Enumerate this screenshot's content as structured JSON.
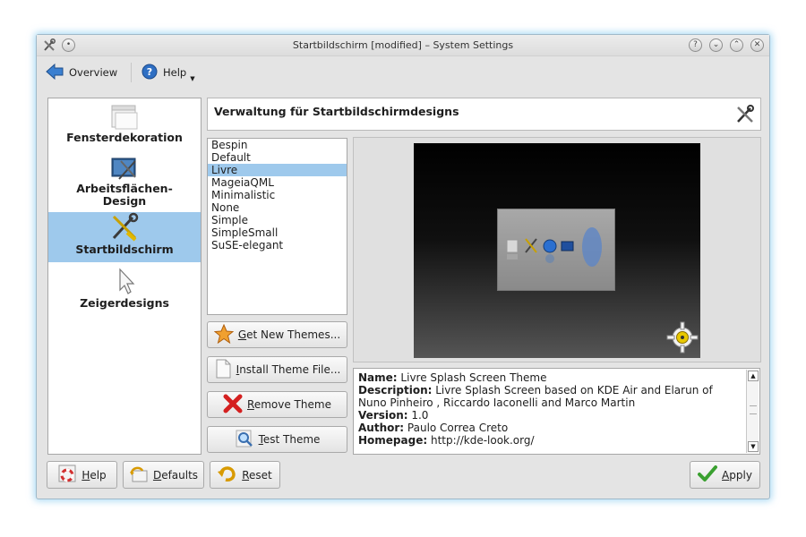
{
  "window": {
    "title": "Startbildschirm [modified] – System Settings"
  },
  "toolbar": {
    "overview_label": "Overview",
    "help_label": "Help"
  },
  "sidebar": {
    "items": [
      {
        "label": "Fensterdekoration",
        "icon": "window-icon"
      },
      {
        "label": "Arbeitsflächen-Design",
        "icon": "desktop-theme-icon"
      },
      {
        "label": "Startbildschirm",
        "icon": "tools-icon",
        "selected": true
      },
      {
        "label": "Zeigerdesigns",
        "icon": "pointer-icon"
      }
    ]
  },
  "header": {
    "title": "Verwaltung für Startbildschirmdesigns"
  },
  "themes": {
    "items": [
      "Bespin",
      "Default",
      "Livre",
      "MageiaQML",
      "Minimalistic",
      "None",
      "Simple",
      "SimpleSmall",
      "SuSE-elegant"
    ],
    "selected": "Livre"
  },
  "buttons": {
    "get_new": {
      "mnemonic": "G",
      "rest": "et New Themes..."
    },
    "install": {
      "mnemonic": "I",
      "rest": "nstall Theme File..."
    },
    "remove": {
      "mnemonic": "R",
      "rest": "emove Theme"
    },
    "test": {
      "mnemonic": "T",
      "rest": "est Theme"
    }
  },
  "info": {
    "name_label": "Name:",
    "name_value": "Livre Splash Screen Theme",
    "desc_label": "Description:",
    "desc_value": "Livre Splash Screen based on KDE Air and Elarun of Nuno Pinheiro , Riccardo Iaconelli and Marco Martin",
    "version_label": "Version:",
    "version_value": "1.0",
    "author_label": "Author:",
    "author_value": "Paulo Correa Creto",
    "homepage_label": "Homepage:",
    "homepage_value": "http://kde-look.org/"
  },
  "footer": {
    "help": {
      "mnemonic": "H",
      "rest": "elp"
    },
    "defaults": {
      "mnemonic": "D",
      "rest": "efaults"
    },
    "reset": {
      "mnemonic": "R",
      "rest": "eset"
    },
    "apply": {
      "mnemonic": "A",
      "rest": "pply"
    }
  },
  "colors": {
    "selection": "#9ec9ec",
    "window_bg": "#e4e4e4",
    "glow": "#6ebeeb"
  }
}
